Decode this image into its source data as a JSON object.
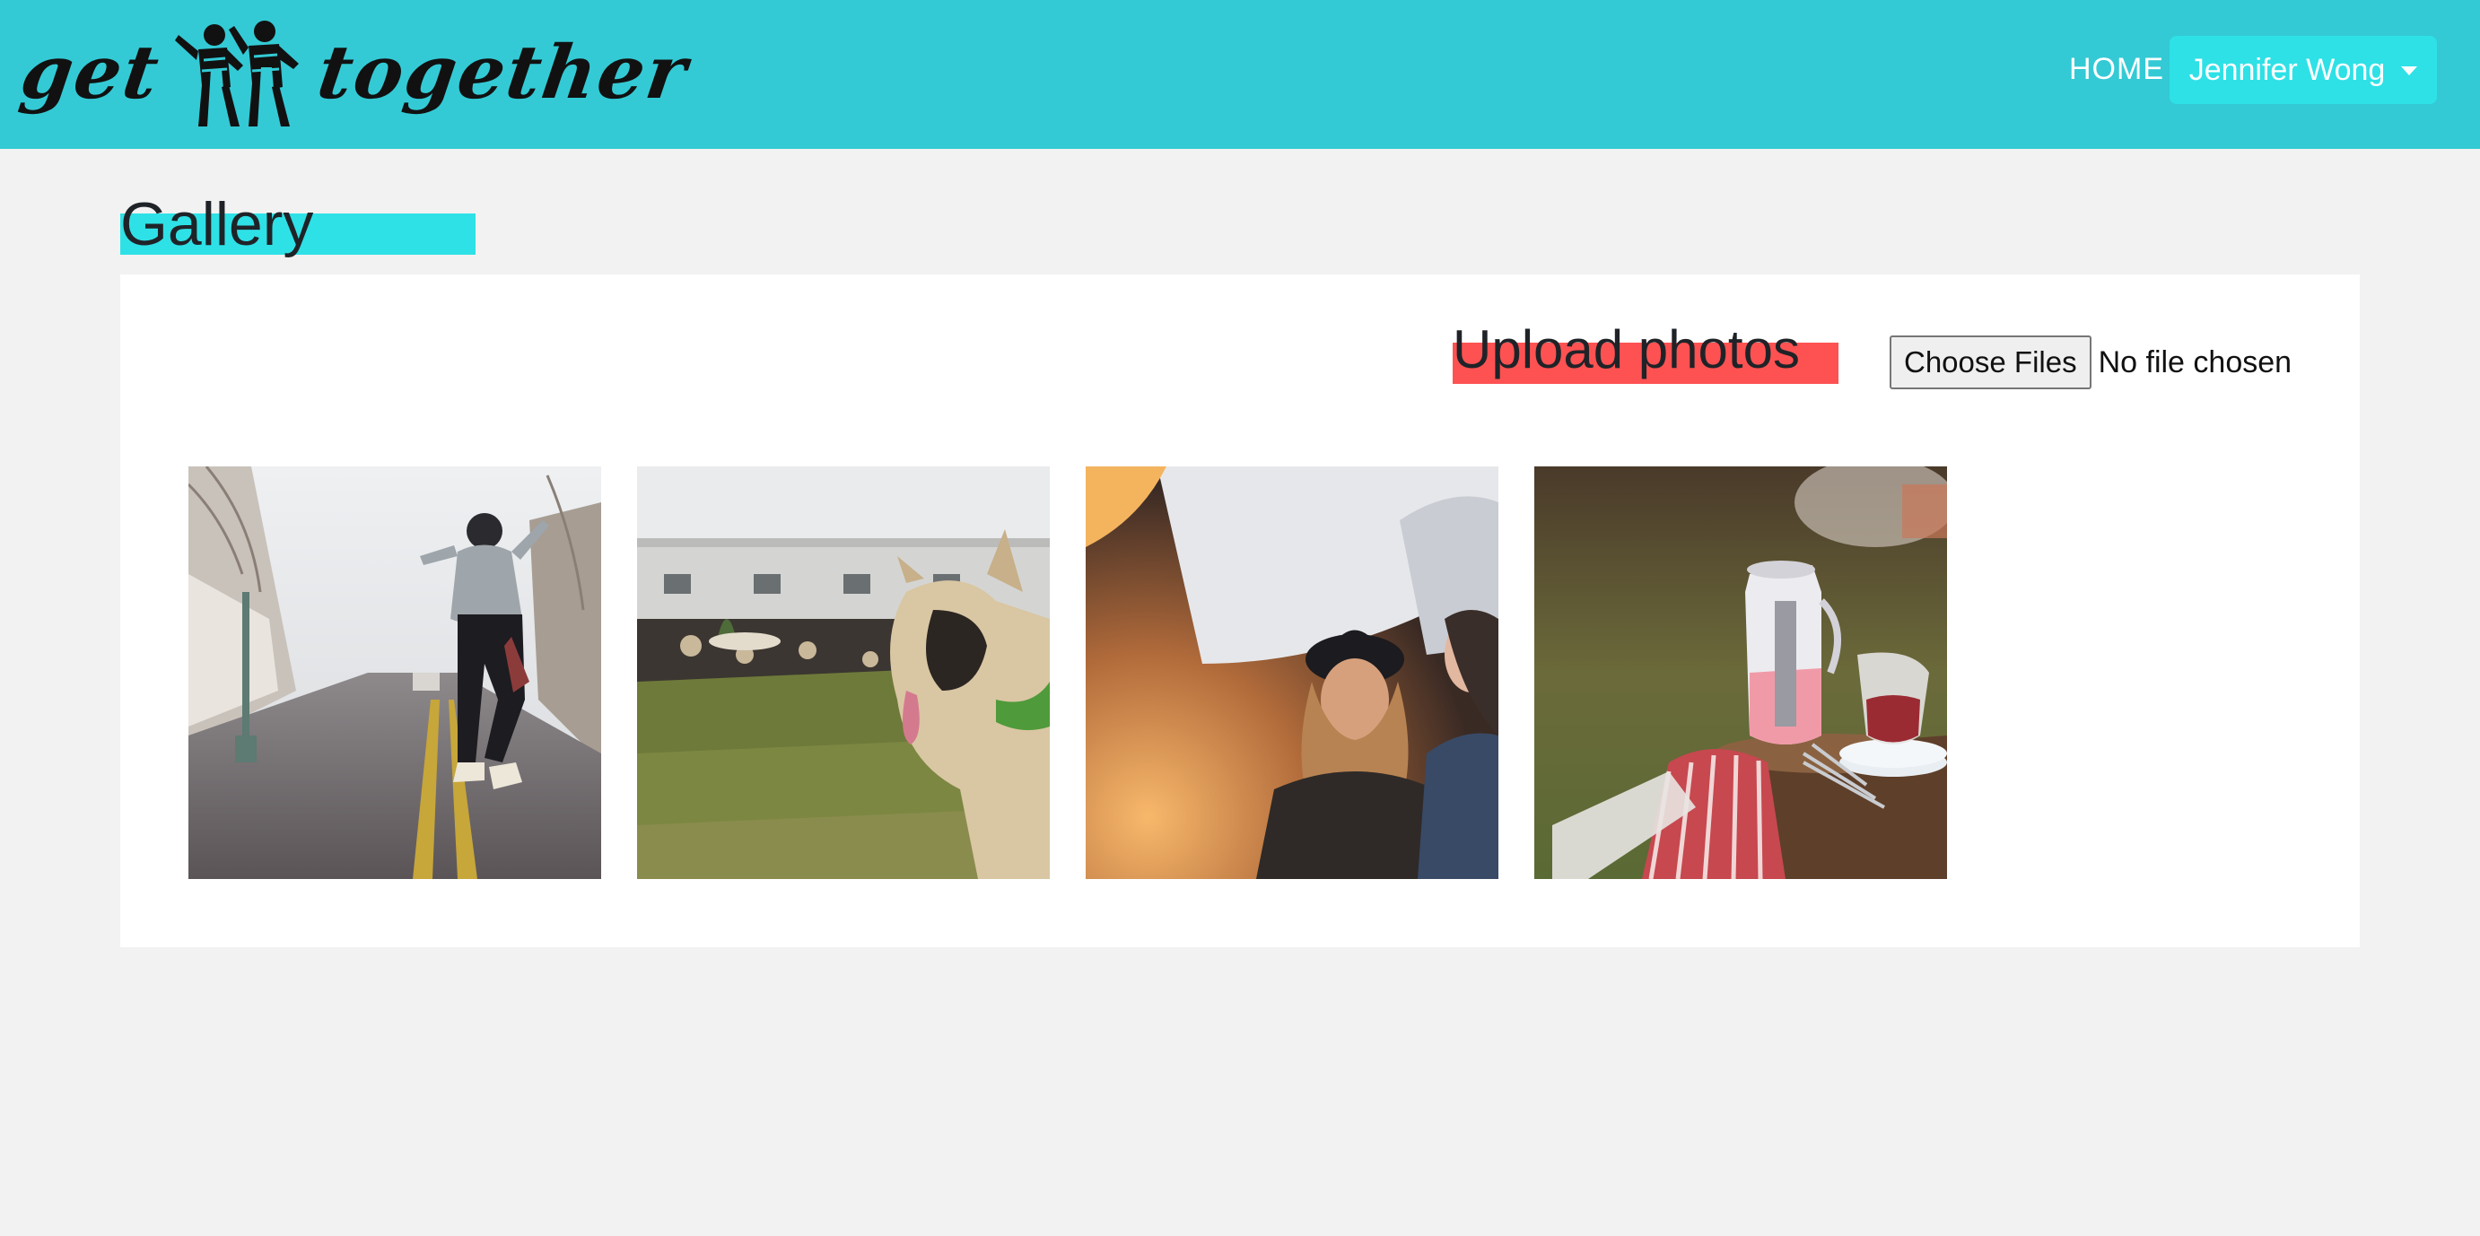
{
  "brand": {
    "word_left": "get",
    "word_right": "together",
    "figures_icon": "dancing-people-icon"
  },
  "nav": {
    "home_label": "HOME",
    "user_name": "Jennifer Wong",
    "user_caret_icon": "caret-down-icon"
  },
  "gallery": {
    "title": "Gallery",
    "upload_title": "Upload photos",
    "choose_files_label": "Choose Files",
    "no_file_text": "No file chosen",
    "photos": [
      {
        "subject": "man-jumping-street-photo"
      },
      {
        "subject": "bulldog-on-grass-photo"
      },
      {
        "subject": "women-laughing-photo"
      },
      {
        "subject": "picnic-pitcher-photo"
      }
    ]
  },
  "colors": {
    "header_bg": "#33cad5",
    "user_button_bg": "#2ee1e6",
    "gallery_accent": "#2ee1e6",
    "upload_accent": "#fe5252",
    "page_bg": "#f2f2f2"
  }
}
